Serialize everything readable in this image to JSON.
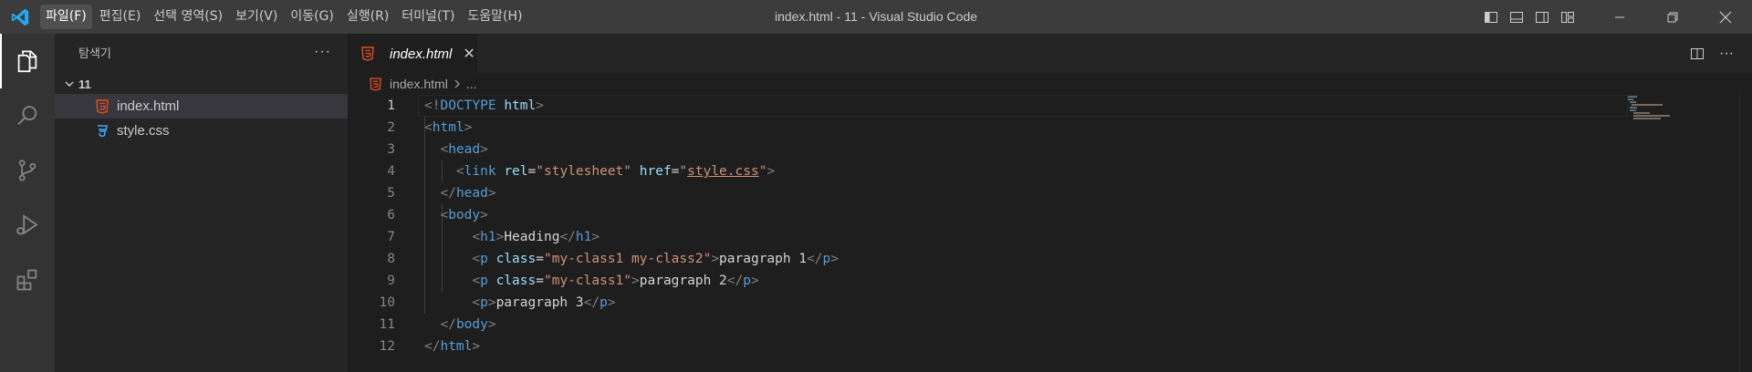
{
  "window": {
    "title": "index.html - 11 - Visual Studio Code"
  },
  "menu": [
    {
      "label": "파일(F)",
      "active": true
    },
    {
      "label": "편집(E)"
    },
    {
      "label": "선택 영역(S)"
    },
    {
      "label": "보기(V)"
    },
    {
      "label": "이동(G)"
    },
    {
      "label": "실행(R)"
    },
    {
      "label": "터미널(T)"
    },
    {
      "label": "도움말(H)"
    }
  ],
  "activity_bar": [
    "files-icon",
    "search-icon",
    "source-control-icon",
    "run-debug-icon",
    "extensions-icon"
  ],
  "sidebar": {
    "title": "탐색기",
    "more": "···",
    "folder": "11",
    "files": [
      {
        "name": "index.html",
        "type": "html",
        "selected": true
      },
      {
        "name": "style.css",
        "type": "css"
      }
    ]
  },
  "editor": {
    "tab": {
      "label": "index.html",
      "close": "✕"
    },
    "breadcrumb": {
      "file": "index.html",
      "rest": "..."
    },
    "line_numbers": [
      "1",
      "2",
      "3",
      "4",
      "5",
      "6",
      "7",
      "8",
      "9",
      "10",
      "11",
      "12"
    ],
    "current_line": 1
  },
  "colors": {
    "html_icon": "#e44d26",
    "css_icon": "#42a5f5",
    "vscode_blue": "#23a9f2"
  }
}
